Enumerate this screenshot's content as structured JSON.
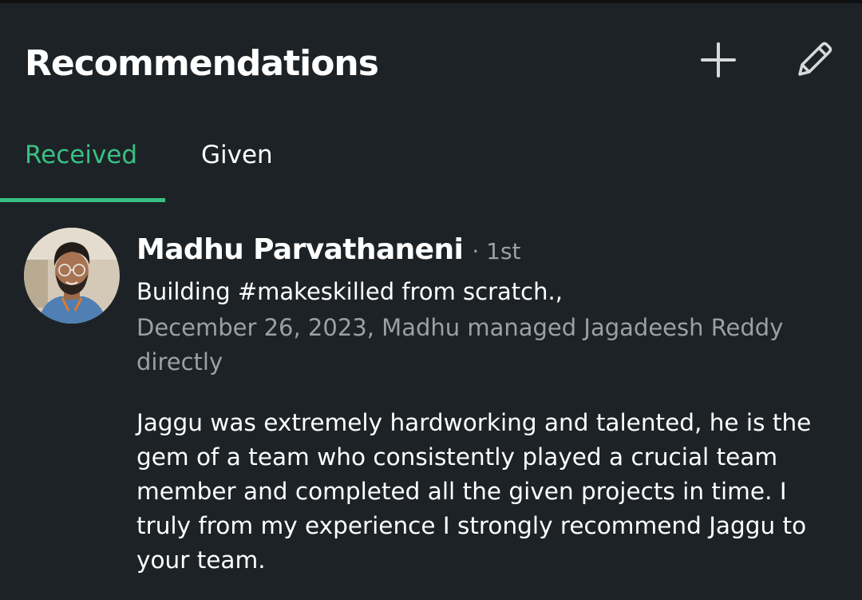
{
  "header": {
    "title": "Recommendations",
    "add_icon": "plus-icon",
    "edit_icon": "pencil-icon"
  },
  "tabs": [
    {
      "label": "Received",
      "active": true
    },
    {
      "label": "Given",
      "active": false
    }
  ],
  "recommendation": {
    "name": "Madhu Parvathaneni",
    "degree": "· 1st",
    "headline": "Building #makeskilled from scratch.,",
    "meta": "December 26, 2023, Madhu managed Jagadeesh Reddy directly",
    "text": "Jaggu was extremely hardworking and talented, he is the gem of a team who consistently played a crucial team member and completed all the given projects in time. I truly from my experience I strongly recommend Jaggu to your team."
  },
  "colors": {
    "background": "#1d2226",
    "accent": "#38c183",
    "secondary_text": "#9ba0a5"
  }
}
